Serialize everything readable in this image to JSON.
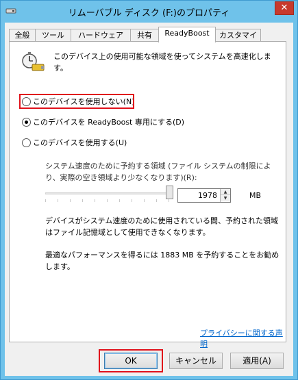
{
  "window": {
    "title": "リムーバブル ディスク (F:)のプロパティ",
    "close_label": "✕"
  },
  "tabs": [
    {
      "label": "全般"
    },
    {
      "label": "ツール"
    },
    {
      "label": "ハードウェア"
    },
    {
      "label": "共有"
    },
    {
      "label": "ReadyBoost",
      "active": true
    },
    {
      "label": "カスタマイズ"
    }
  ],
  "readyboost": {
    "description": "このデバイス上の使用可能な領域を使ってシステムを高速化します。",
    "options": [
      {
        "label": "このデバイスを使用しない(N)",
        "checked": false
      },
      {
        "label": "このデバイスを ReadyBoost 専用にする(D)",
        "checked": true
      },
      {
        "label": "このデバイスを使用する(U)",
        "checked": false
      }
    ],
    "space_label": "システム速度のために予約する領域 (ファイル システムの制限により、実際の空き領域より少なくなります)(R):",
    "slider_fraction": 1.0,
    "reserve_value": "1978",
    "unit": "MB",
    "info_reserved": "デバイスがシステム速度のために使用されている間、予約された領域はファイル記憶域として使用できなくなります。",
    "info_recommend": "最適なパフォーマンスを得るには 1883 MB を予約することをお勧めします。",
    "privacy_link": "プライバシーに関する声明"
  },
  "buttons": {
    "ok": "OK",
    "cancel": "キャンセル",
    "apply": "適用(A)"
  },
  "colors": {
    "titlebar": "#6fc2ea",
    "highlight": "#e0101a",
    "link": "#0066cc"
  }
}
